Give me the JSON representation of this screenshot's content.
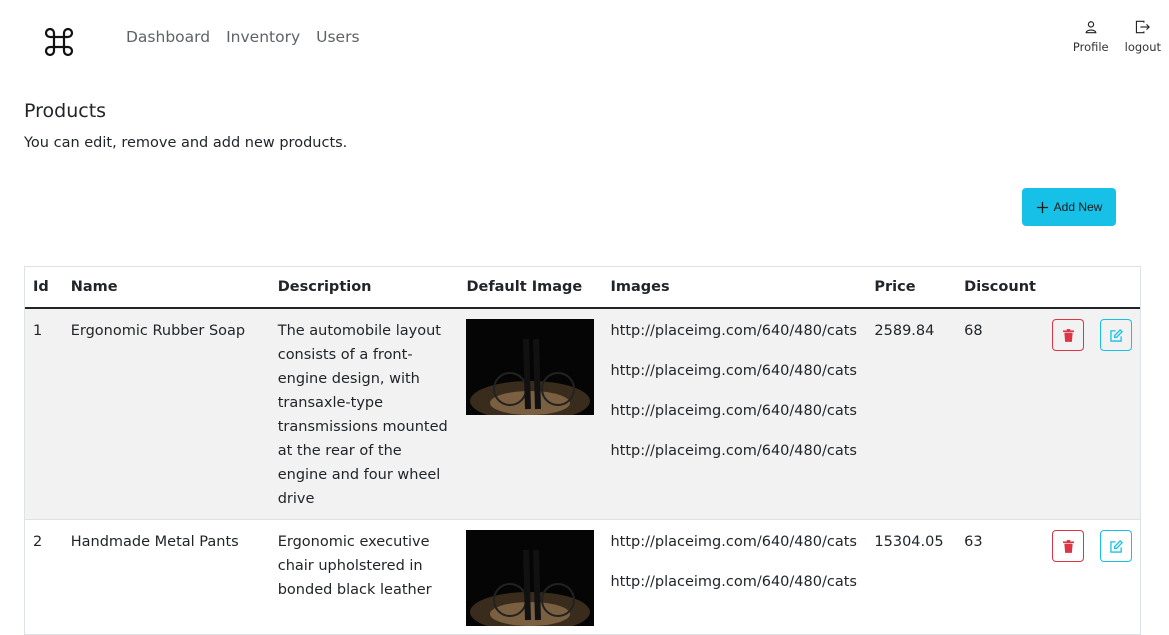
{
  "nav": {
    "links": [
      "Dashboard",
      "Inventory",
      "Users"
    ],
    "profile_label": "Profile",
    "logout_label": "logout"
  },
  "page": {
    "title": "Products",
    "description": "You can edit, remove and add new products.",
    "add_button_label": "Add New"
  },
  "table": {
    "headers": [
      "Id",
      "Name",
      "Description",
      "Default Image",
      "Images",
      "Price",
      "Discount"
    ],
    "rows": [
      {
        "id": "1",
        "name": "Ergonomic Rubber Soap",
        "description": "The automobile layout consists of a front-engine design, with transaxle-type transmissions mounted at the rear of the engine and four wheel drive",
        "images": [
          "http://placeimg.com/640/480/cats",
          "http://placeimg.com/640/480/cats",
          "http://placeimg.com/640/480/cats",
          "http://placeimg.com/640/480/cats"
        ],
        "price": "2589.84",
        "discount": "68"
      },
      {
        "id": "2",
        "name": "Handmade Metal Pants",
        "description": "Ergonomic executive chair upholstered in bonded black leather",
        "images": [
          "http://placeimg.com/640/480/cats",
          "http://placeimg.com/640/480/cats"
        ],
        "price": "15304.05",
        "discount": "63"
      }
    ]
  },
  "colors": {
    "accent": "#17c0e6",
    "danger": "#dc3545",
    "row_stripe": "#f2f2f2"
  },
  "icons": [
    "command-icon",
    "user-icon",
    "logout-icon",
    "plus-icon",
    "trash-icon",
    "edit-icon"
  ]
}
